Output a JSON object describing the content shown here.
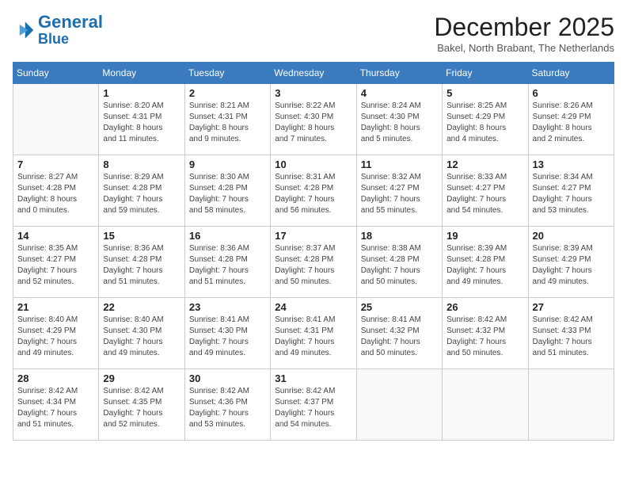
{
  "header": {
    "logo_general": "General",
    "logo_blue": "Blue",
    "month_title": "December 2025",
    "location": "Bakel, North Brabant, The Netherlands"
  },
  "weekdays": [
    "Sunday",
    "Monday",
    "Tuesday",
    "Wednesday",
    "Thursday",
    "Friday",
    "Saturday"
  ],
  "weeks": [
    [
      {
        "day": "",
        "info": ""
      },
      {
        "day": "1",
        "info": "Sunrise: 8:20 AM\nSunset: 4:31 PM\nDaylight: 8 hours\nand 11 minutes."
      },
      {
        "day": "2",
        "info": "Sunrise: 8:21 AM\nSunset: 4:31 PM\nDaylight: 8 hours\nand 9 minutes."
      },
      {
        "day": "3",
        "info": "Sunrise: 8:22 AM\nSunset: 4:30 PM\nDaylight: 8 hours\nand 7 minutes."
      },
      {
        "day": "4",
        "info": "Sunrise: 8:24 AM\nSunset: 4:30 PM\nDaylight: 8 hours\nand 5 minutes."
      },
      {
        "day": "5",
        "info": "Sunrise: 8:25 AM\nSunset: 4:29 PM\nDaylight: 8 hours\nand 4 minutes."
      },
      {
        "day": "6",
        "info": "Sunrise: 8:26 AM\nSunset: 4:29 PM\nDaylight: 8 hours\nand 2 minutes."
      }
    ],
    [
      {
        "day": "7",
        "info": "Sunrise: 8:27 AM\nSunset: 4:28 PM\nDaylight: 8 hours\nand 0 minutes."
      },
      {
        "day": "8",
        "info": "Sunrise: 8:29 AM\nSunset: 4:28 PM\nDaylight: 7 hours\nand 59 minutes."
      },
      {
        "day": "9",
        "info": "Sunrise: 8:30 AM\nSunset: 4:28 PM\nDaylight: 7 hours\nand 58 minutes."
      },
      {
        "day": "10",
        "info": "Sunrise: 8:31 AM\nSunset: 4:28 PM\nDaylight: 7 hours\nand 56 minutes."
      },
      {
        "day": "11",
        "info": "Sunrise: 8:32 AM\nSunset: 4:27 PM\nDaylight: 7 hours\nand 55 minutes."
      },
      {
        "day": "12",
        "info": "Sunrise: 8:33 AM\nSunset: 4:27 PM\nDaylight: 7 hours\nand 54 minutes."
      },
      {
        "day": "13",
        "info": "Sunrise: 8:34 AM\nSunset: 4:27 PM\nDaylight: 7 hours\nand 53 minutes."
      }
    ],
    [
      {
        "day": "14",
        "info": "Sunrise: 8:35 AM\nSunset: 4:27 PM\nDaylight: 7 hours\nand 52 minutes."
      },
      {
        "day": "15",
        "info": "Sunrise: 8:36 AM\nSunset: 4:28 PM\nDaylight: 7 hours\nand 51 minutes."
      },
      {
        "day": "16",
        "info": "Sunrise: 8:36 AM\nSunset: 4:28 PM\nDaylight: 7 hours\nand 51 minutes."
      },
      {
        "day": "17",
        "info": "Sunrise: 8:37 AM\nSunset: 4:28 PM\nDaylight: 7 hours\nand 50 minutes."
      },
      {
        "day": "18",
        "info": "Sunrise: 8:38 AM\nSunset: 4:28 PM\nDaylight: 7 hours\nand 50 minutes."
      },
      {
        "day": "19",
        "info": "Sunrise: 8:39 AM\nSunset: 4:28 PM\nDaylight: 7 hours\nand 49 minutes."
      },
      {
        "day": "20",
        "info": "Sunrise: 8:39 AM\nSunset: 4:29 PM\nDaylight: 7 hours\nand 49 minutes."
      }
    ],
    [
      {
        "day": "21",
        "info": "Sunrise: 8:40 AM\nSunset: 4:29 PM\nDaylight: 7 hours\nand 49 minutes."
      },
      {
        "day": "22",
        "info": "Sunrise: 8:40 AM\nSunset: 4:30 PM\nDaylight: 7 hours\nand 49 minutes."
      },
      {
        "day": "23",
        "info": "Sunrise: 8:41 AM\nSunset: 4:30 PM\nDaylight: 7 hours\nand 49 minutes."
      },
      {
        "day": "24",
        "info": "Sunrise: 8:41 AM\nSunset: 4:31 PM\nDaylight: 7 hours\nand 49 minutes."
      },
      {
        "day": "25",
        "info": "Sunrise: 8:41 AM\nSunset: 4:32 PM\nDaylight: 7 hours\nand 50 minutes."
      },
      {
        "day": "26",
        "info": "Sunrise: 8:42 AM\nSunset: 4:32 PM\nDaylight: 7 hours\nand 50 minutes."
      },
      {
        "day": "27",
        "info": "Sunrise: 8:42 AM\nSunset: 4:33 PM\nDaylight: 7 hours\nand 51 minutes."
      }
    ],
    [
      {
        "day": "28",
        "info": "Sunrise: 8:42 AM\nSunset: 4:34 PM\nDaylight: 7 hours\nand 51 minutes."
      },
      {
        "day": "29",
        "info": "Sunrise: 8:42 AM\nSunset: 4:35 PM\nDaylight: 7 hours\nand 52 minutes."
      },
      {
        "day": "30",
        "info": "Sunrise: 8:42 AM\nSunset: 4:36 PM\nDaylight: 7 hours\nand 53 minutes."
      },
      {
        "day": "31",
        "info": "Sunrise: 8:42 AM\nSunset: 4:37 PM\nDaylight: 7 hours\nand 54 minutes."
      },
      {
        "day": "",
        "info": ""
      },
      {
        "day": "",
        "info": ""
      },
      {
        "day": "",
        "info": ""
      }
    ]
  ]
}
